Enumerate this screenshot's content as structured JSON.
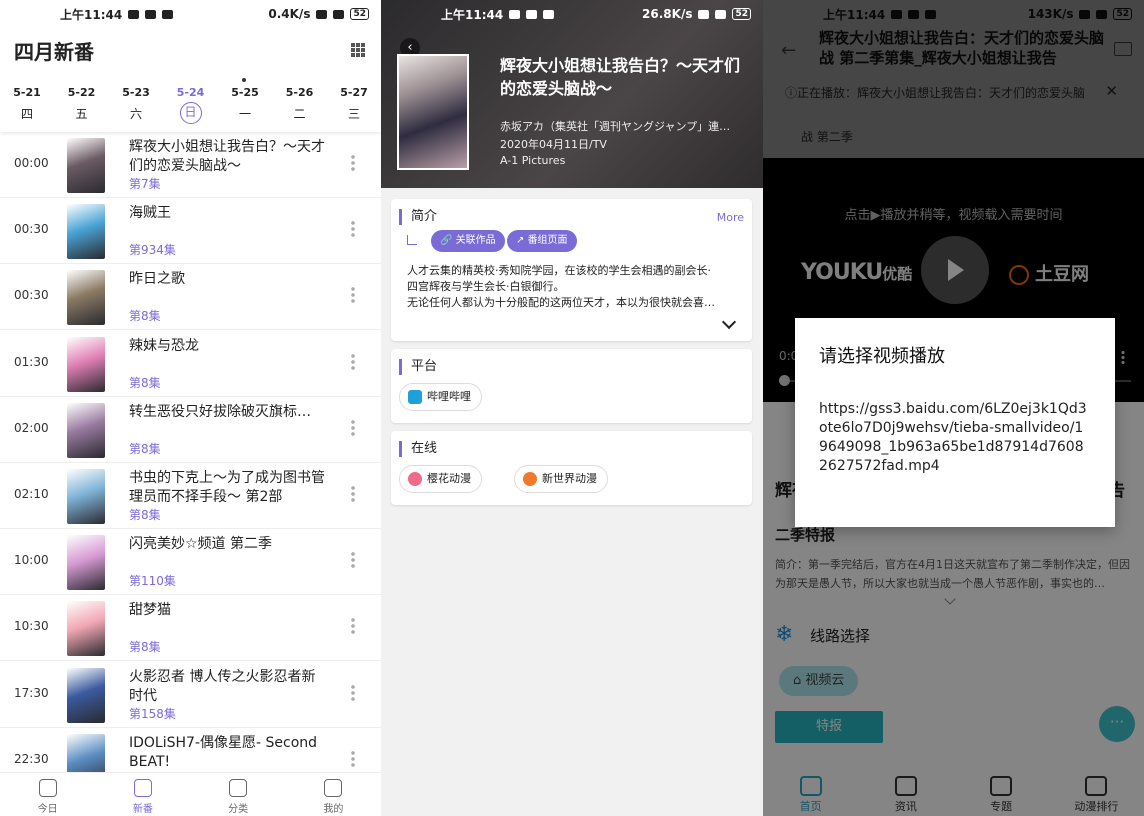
{
  "status_bars": [
    {
      "time": "上午11:44",
      "speed": "0.4K/s",
      "battery": "52"
    },
    {
      "time": "上午11:44",
      "speed": "26.8K/s",
      "battery": "52"
    },
    {
      "time": "上午11:44",
      "speed": "143K/s",
      "battery": "52"
    }
  ],
  "schedule": {
    "title": "四月新番",
    "days": [
      {
        "date": "5-21",
        "weekday": "四"
      },
      {
        "date": "5-22",
        "weekday": "五"
      },
      {
        "date": "5-23",
        "weekday": "六"
      },
      {
        "date": "5-24",
        "weekday": "日"
      },
      {
        "date": "5-25",
        "weekday": "一"
      },
      {
        "date": "5-26",
        "weekday": "二"
      },
      {
        "date": "5-27",
        "weekday": "三"
      }
    ],
    "selected_day": 3,
    "items": [
      {
        "time": "00:00",
        "name": "辉夜大小姐想让我告白？～天才们的恋爱头脑战～",
        "episode": "第7集",
        "color": "#6b5a63"
      },
      {
        "time": "00:30",
        "name": "海贼王",
        "episode": "第934集",
        "color": "#4aa3d6"
      },
      {
        "time": "00:30",
        "name": "昨日之歌",
        "episode": "第8集",
        "color": "#8a7a64"
      },
      {
        "time": "01:30",
        "name": "辣妹与恐龙",
        "episode": "第8集",
        "color": "#e07fb4"
      },
      {
        "time": "02:00",
        "name": "转生恶役只好拔除破灭旗标…",
        "episode": "第8集",
        "color": "#9a7aa0"
      },
      {
        "time": "02:10",
        "name": "书虫的下克上～为了成为图书管理员而不择手段～ 第2部",
        "episode": "第8集",
        "color": "#7fb3d8"
      },
      {
        "time": "10:00",
        "name": "闪亮美妙☆频道 第二季",
        "episode": "第110集",
        "color": "#d79bd4"
      },
      {
        "time": "10:30",
        "name": "甜梦猫",
        "episode": "第8集",
        "color": "#f1a7b4"
      },
      {
        "time": "17:30",
        "name": "火影忍者 博人传之火影忍者新时代",
        "episode": "第158集",
        "color": "#3b5aa0"
      },
      {
        "time": "22:30",
        "name": "IDOLiSH7-偶像星愿- Second BEAT!",
        "episode": "",
        "color": "#5a8cc2"
      }
    ],
    "tabs": [
      {
        "label": "今日"
      },
      {
        "label": "新番"
      },
      {
        "label": "分类"
      },
      {
        "label": "我的"
      }
    ],
    "active_tab": 1
  },
  "detail": {
    "title": "辉夜大小姐想让我告白？～天才们的恋爱头脑战～",
    "author": "赤坂アカ（集英社「週刊ヤングジャンプ」連…",
    "date": "2020年04月11日/TV",
    "studio": "A-1 Pictures",
    "intro_header": "简介",
    "more": "More",
    "pill_related": "关联作品",
    "pill_page": "番组页面",
    "intro_line1": "人才云集的精英校·秀知院学园，在该校的学生会相遇的副会长·",
    "intro_line2": "四宫辉夜与学生会长·白银御行。",
    "intro_line3": "无论任何人都认为十分般配的这两位天才，本以为很快就会喜…",
    "platform_header": "平台",
    "platform": "哔哩哔哩",
    "online_header": "在线",
    "online": [
      {
        "label": "樱花动漫",
        "color": "#f06a8a"
      },
      {
        "label": "新世界动漫",
        "color": "#f07a2a"
      }
    ]
  },
  "player": {
    "title": "辉夜大小姐想让我告白：天才们的恋爱头脑战 第二季第集_辉夜大小姐想让我告",
    "now_playing": "ⓘ正在播放：辉夜大小姐想让我告白：天才们的恋爱头脑",
    "now_playing_sub": "战 第二季",
    "hint": "点击▶播放并稍等，视频载入需要时间",
    "youku": "YOUKU",
    "youku_cn": "优酷",
    "tudou": "土豆网",
    "time": "0:0",
    "body_title": "辉夜",
    "body_title_end": "告",
    "special": "二季特报",
    "desc": "简介：第一季完结后，官方在4月1日这天就宣布了第二季制作决定，但因为那天是愚人节，所以大家也就当成一个愚人节恶作剧，事实也的…",
    "route": "线路选择",
    "line": "视频云",
    "special_btn": "特报",
    "fab": "···",
    "tabs": [
      {
        "label": "首页"
      },
      {
        "label": "资讯"
      },
      {
        "label": "专题"
      },
      {
        "label": "动漫排行"
      }
    ],
    "dialog_title": "请选择视频播放",
    "dialog_url": "https://gss3.baidu.com/6LZ0ej3k1Qd3ote6lo7D0j9wehsv/tieba-smallvideo/19649098_1b963a65be1d87914d76082627572fad.mp4"
  },
  "colors": {
    "accent": "#7b6bd6",
    "teal": "#25b6c2"
  }
}
